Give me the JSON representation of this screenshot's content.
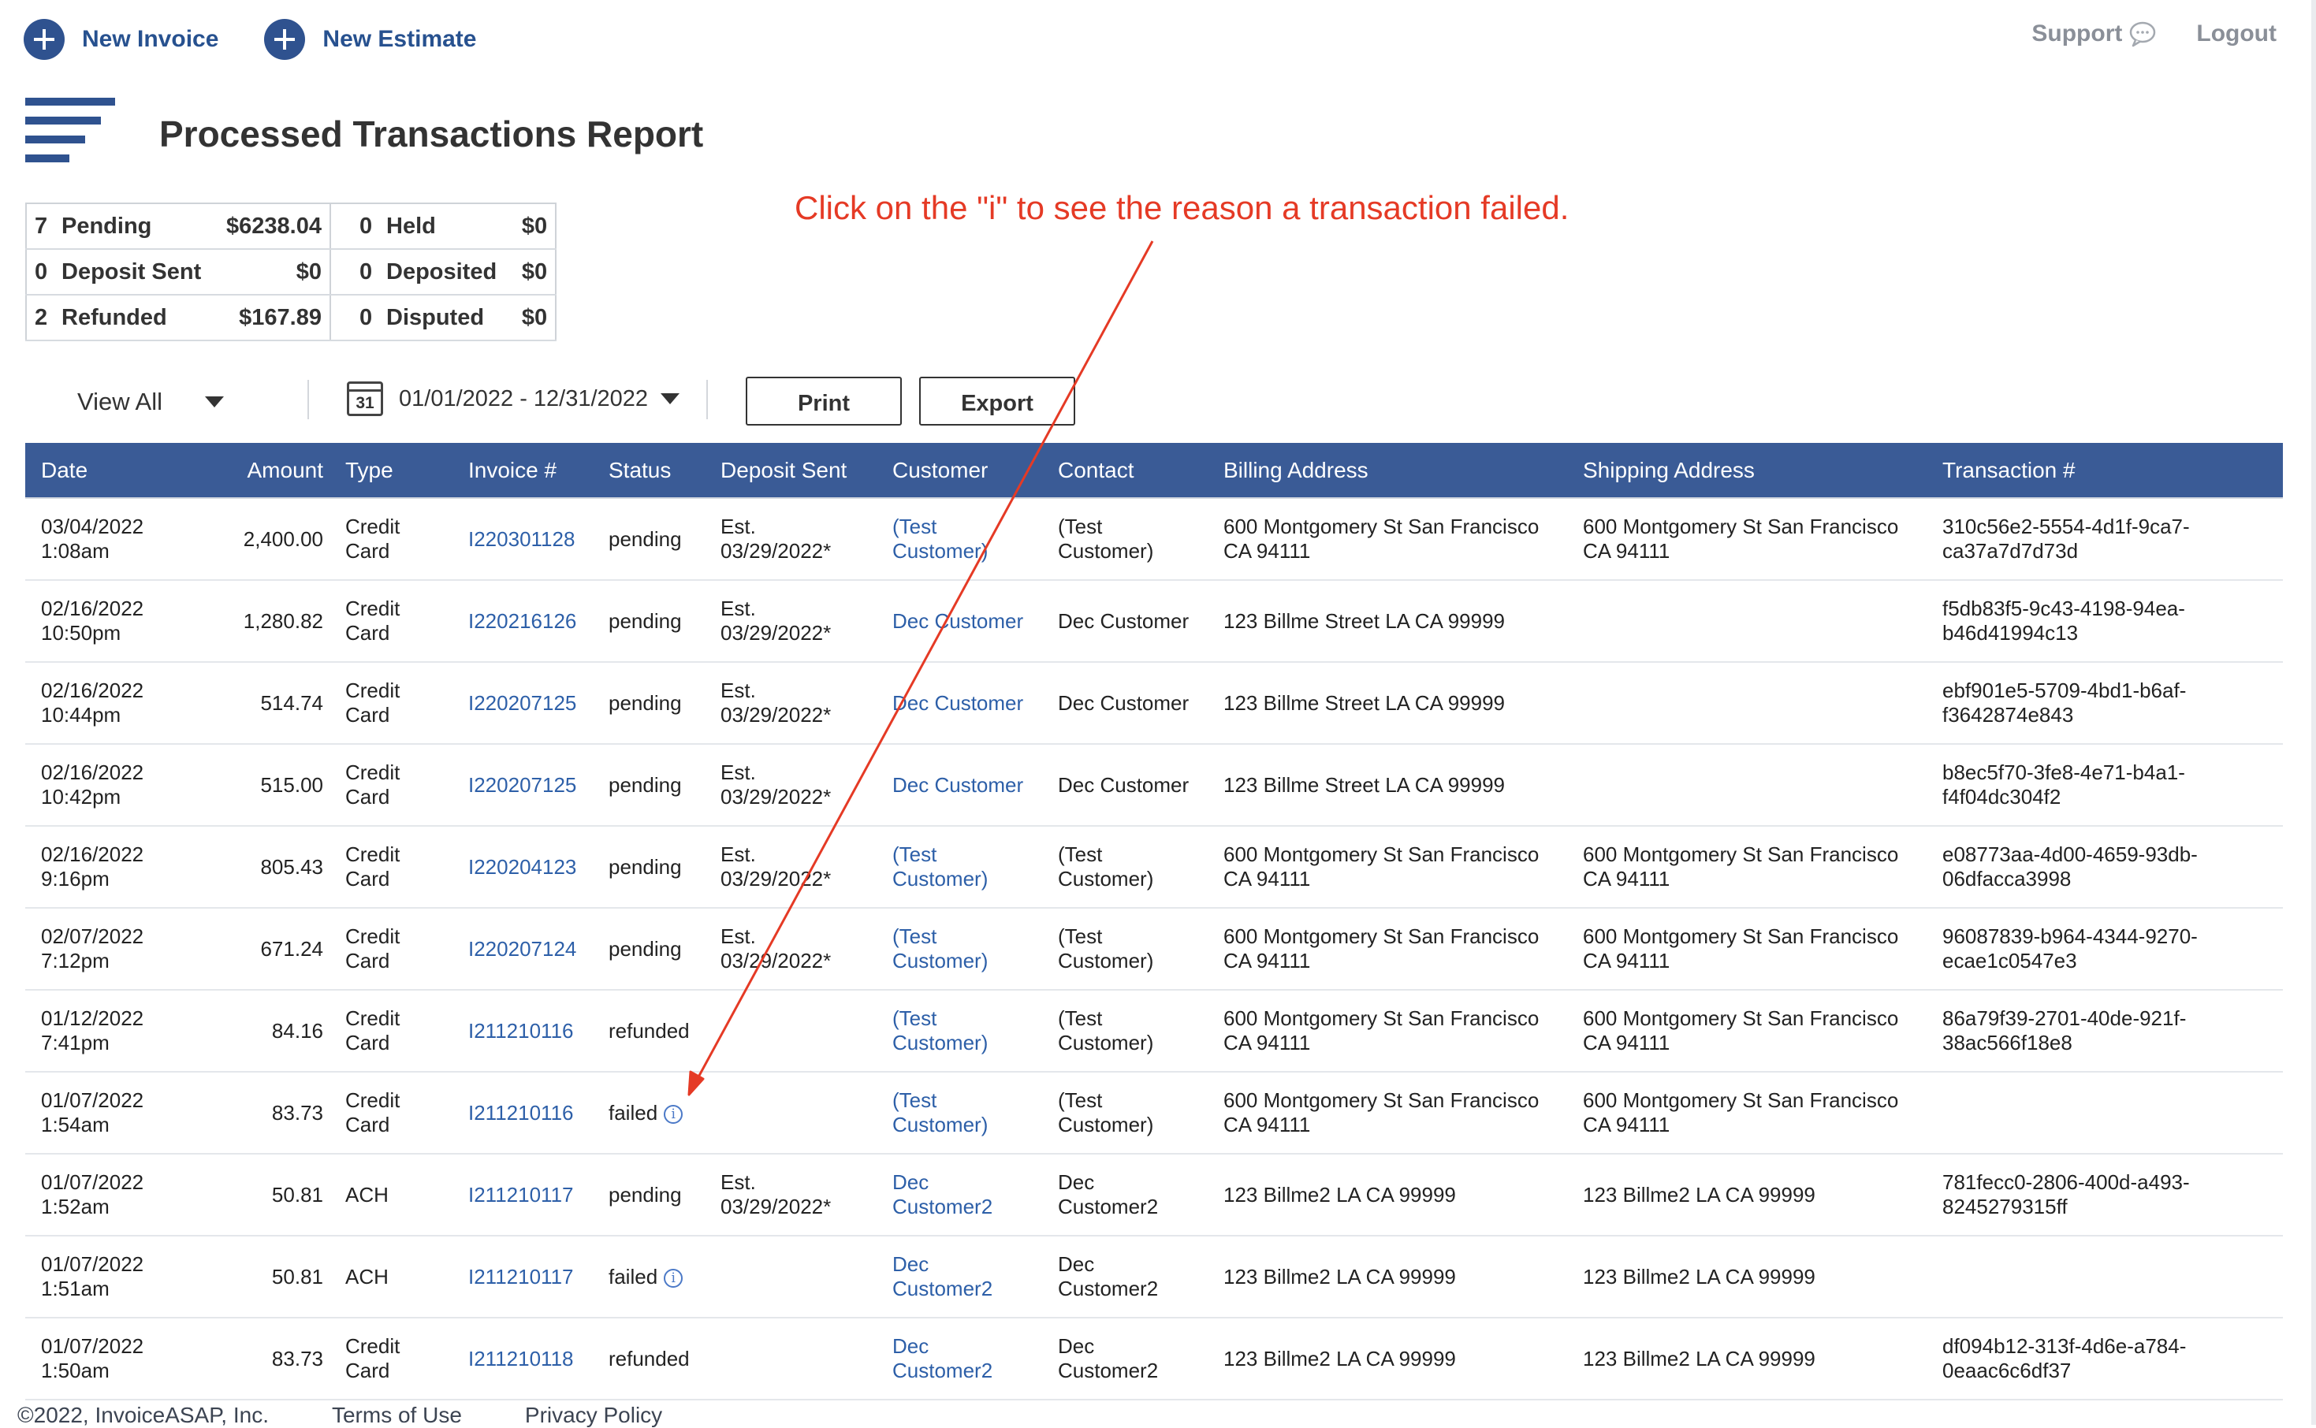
{
  "header": {
    "new_invoice": "New Invoice",
    "new_estimate": "New Estimate",
    "support": "Support",
    "logout": "Logout"
  },
  "page_title": "Processed Transactions Report",
  "summary": [
    [
      {
        "count": "7",
        "label": "Pending",
        "amount": "$6238.04"
      },
      {
        "count": "0",
        "label": "Held",
        "amount": "$0"
      }
    ],
    [
      {
        "count": "0",
        "label": "Deposit Sent",
        "amount": "$0"
      },
      {
        "count": "0",
        "label": "Deposited",
        "amount": "$0"
      }
    ],
    [
      {
        "count": "2",
        "label": "Refunded",
        "amount": "$167.89"
      },
      {
        "count": "0",
        "label": "Disputed",
        "amount": "$0"
      }
    ]
  ],
  "annotation": "Click on the \"i\" to see the reason a transaction failed.",
  "toolbar": {
    "filter": "View All",
    "calendar_day": "31",
    "date_range": "01/01/2022 - 12/31/2022",
    "print": "Print",
    "export": "Export"
  },
  "table": {
    "columns": [
      "Date",
      "Amount",
      "Type",
      "Invoice #",
      "Status",
      "Deposit Sent",
      "Customer",
      "Contact",
      "Billing Address",
      "Shipping Address",
      "Transaction #"
    ],
    "rows": [
      {
        "date": "03/04/2022",
        "time": "1:08am",
        "amount": "2,400.00",
        "type1": "Credit",
        "type2": "Card",
        "invoice": "I220301128",
        "status": "pending",
        "info": false,
        "dep1": "Est.",
        "dep2": "03/29/2022*",
        "cust1": "(Test",
        "cust2": "Customer)",
        "cont1": "(Test",
        "cont2": "Customer)",
        "bill1": "600 Montgomery St San Francisco",
        "bill2": "CA 94111",
        "ship1": "600 Montgomery St San Francisco",
        "ship2": "CA 94111",
        "tx1": "310c56e2-5554-4d1f-9ca7-",
        "tx2": "ca37a7d7d73d"
      },
      {
        "date": "02/16/2022",
        "time": "10:50pm",
        "amount": "1,280.82",
        "type1": "Credit",
        "type2": "Card",
        "invoice": "I220216126",
        "status": "pending",
        "info": false,
        "dep1": "Est.",
        "dep2": "03/29/2022*",
        "cust1": "Dec Customer",
        "cust2": "",
        "cont1": "Dec Customer",
        "cont2": "",
        "bill1": "123 Billme Street LA CA 99999",
        "bill2": "",
        "ship1": "",
        "ship2": "",
        "tx1": "f5db83f5-9c43-4198-94ea-",
        "tx2": "b46d41994c13"
      },
      {
        "date": "02/16/2022",
        "time": "10:44pm",
        "amount": "514.74",
        "type1": "Credit",
        "type2": "Card",
        "invoice": "I220207125",
        "status": "pending",
        "info": false,
        "dep1": "Est.",
        "dep2": "03/29/2022*",
        "cust1": "Dec Customer",
        "cust2": "",
        "cont1": "Dec Customer",
        "cont2": "",
        "bill1": "123 Billme Street LA CA 99999",
        "bill2": "",
        "ship1": "",
        "ship2": "",
        "tx1": "ebf901e5-5709-4bd1-b6af-",
        "tx2": "f3642874e843"
      },
      {
        "date": "02/16/2022",
        "time": "10:42pm",
        "amount": "515.00",
        "type1": "Credit",
        "type2": "Card",
        "invoice": "I220207125",
        "status": "pending",
        "info": false,
        "dep1": "Est.",
        "dep2": "03/29/2022*",
        "cust1": "Dec Customer",
        "cust2": "",
        "cont1": "Dec Customer",
        "cont2": "",
        "bill1": "123 Billme Street LA CA 99999",
        "bill2": "",
        "ship1": "",
        "ship2": "",
        "tx1": "b8ec5f70-3fe8-4e71-b4a1-",
        "tx2": "f4f04dc304f2"
      },
      {
        "date": "02/16/2022",
        "time": "9:16pm",
        "amount": "805.43",
        "type1": "Credit",
        "type2": "Card",
        "invoice": "I220204123",
        "status": "pending",
        "info": false,
        "dep1": "Est.",
        "dep2": "03/29/2022*",
        "cust1": "(Test",
        "cust2": "Customer)",
        "cont1": "(Test",
        "cont2": "Customer)",
        "bill1": "600 Montgomery St San Francisco",
        "bill2": "CA 94111",
        "ship1": "600 Montgomery St San Francisco",
        "ship2": "CA 94111",
        "tx1": "e08773aa-4d00-4659-93db-",
        "tx2": "06dfacca3998"
      },
      {
        "date": "02/07/2022",
        "time": "7:12pm",
        "amount": "671.24",
        "type1": "Credit",
        "type2": "Card",
        "invoice": "I220207124",
        "status": "pending",
        "info": false,
        "dep1": "Est.",
        "dep2": "03/29/2022*",
        "cust1": "(Test",
        "cust2": "Customer)",
        "cont1": "(Test",
        "cont2": "Customer)",
        "bill1": "600 Montgomery St San Francisco",
        "bill2": "CA 94111",
        "ship1": "600 Montgomery St San Francisco",
        "ship2": "CA 94111",
        "tx1": "96087839-b964-4344-9270-",
        "tx2": "ecae1c0547e3"
      },
      {
        "date": "01/12/2022",
        "time": "7:41pm",
        "amount": "84.16",
        "type1": "Credit",
        "type2": "Card",
        "invoice": "I211210116",
        "status": "refunded",
        "info": false,
        "dep1": "",
        "dep2": "",
        "cust1": "(Test",
        "cust2": "Customer)",
        "cont1": "(Test",
        "cont2": "Customer)",
        "bill1": "600 Montgomery St San Francisco",
        "bill2": "CA 94111",
        "ship1": "600 Montgomery St San Francisco",
        "ship2": "CA 94111",
        "tx1": "86a79f39-2701-40de-921f-",
        "tx2": "38ac566f18e8"
      },
      {
        "date": "01/07/2022",
        "time": "1:54am",
        "amount": "83.73",
        "type1": "Credit",
        "type2": "Card",
        "invoice": "I211210116",
        "status": "failed",
        "info": true,
        "dep1": "",
        "dep2": "",
        "cust1": "(Test",
        "cust2": "Customer)",
        "cont1": "(Test",
        "cont2": "Customer)",
        "bill1": "600 Montgomery St San Francisco",
        "bill2": "CA 94111",
        "ship1": "600 Montgomery St San Francisco",
        "ship2": "CA 94111",
        "tx1": "",
        "tx2": ""
      },
      {
        "date": "01/07/2022",
        "time": "1:52am",
        "amount": "50.81",
        "type1": "ACH",
        "type2": "",
        "invoice": "I211210117",
        "status": "pending",
        "info": false,
        "dep1": "Est.",
        "dep2": "03/29/2022*",
        "cust1": "Dec",
        "cust2": "Customer2",
        "cont1": "Dec",
        "cont2": "Customer2",
        "bill1": "123 Billme2 LA CA 99999",
        "bill2": "",
        "ship1": "123 Billme2 LA CA 99999",
        "ship2": "",
        "tx1": "781fecc0-2806-400d-a493-",
        "tx2": "8245279315ff"
      },
      {
        "date": "01/07/2022",
        "time": "1:51am",
        "amount": "50.81",
        "type1": "ACH",
        "type2": "",
        "invoice": "I211210117",
        "status": "failed",
        "info": true,
        "dep1": "",
        "dep2": "",
        "cust1": "Dec",
        "cust2": "Customer2",
        "cont1": "Dec",
        "cont2": "Customer2",
        "bill1": "123 Billme2 LA CA 99999",
        "bill2": "",
        "ship1": "123 Billme2 LA CA 99999",
        "ship2": "",
        "tx1": "",
        "tx2": ""
      },
      {
        "date": "01/07/2022",
        "time": "1:50am",
        "amount": "83.73",
        "type1": "Credit",
        "type2": "Card",
        "invoice": "I211210118",
        "status": "refunded",
        "info": false,
        "dep1": "",
        "dep2": "",
        "cust1": "Dec",
        "cust2": "Customer2",
        "cont1": "Dec",
        "cont2": "Customer2",
        "bill1": "123 Billme2 LA CA 99999",
        "bill2": "",
        "ship1": "123 Billme2 LA CA 99999",
        "ship2": "",
        "tx1": "df094b12-313f-4d6e-a784-",
        "tx2": "0eaac6c6df37"
      }
    ]
  },
  "footer": {
    "copyright": "©2022, InvoiceASAP, Inc.",
    "terms": "Terms of Use",
    "privacy": "Privacy Policy"
  },
  "colors": {
    "brand_blue": "#2f528f",
    "header_blue": "#3a5b96",
    "link_blue": "#2d5fa8",
    "annotation_red": "#e53a25"
  }
}
